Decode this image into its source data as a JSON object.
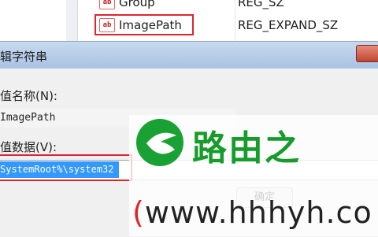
{
  "registry": {
    "rows": [
      {
        "name": "Group",
        "type": "REG_SZ"
      },
      {
        "name": "ImagePath",
        "type": "REG_EXPAND_SZ"
      }
    ],
    "icon_text": "ab"
  },
  "dialog": {
    "title": "辑字符串",
    "name_label": "值名称(N):",
    "name_value": "ImagePath",
    "data_label": "值数据(V):",
    "data_value": "SystemRoot%\\system32",
    "ok_label": "确定"
  },
  "watermark": {
    "brand": "路由之",
    "url_paren": "(",
    "url": "www.hhhyh.co"
  },
  "colors": {
    "highlight_border": "#e0242d",
    "selection": "#3399ff",
    "brand_green": "#179c2c"
  }
}
